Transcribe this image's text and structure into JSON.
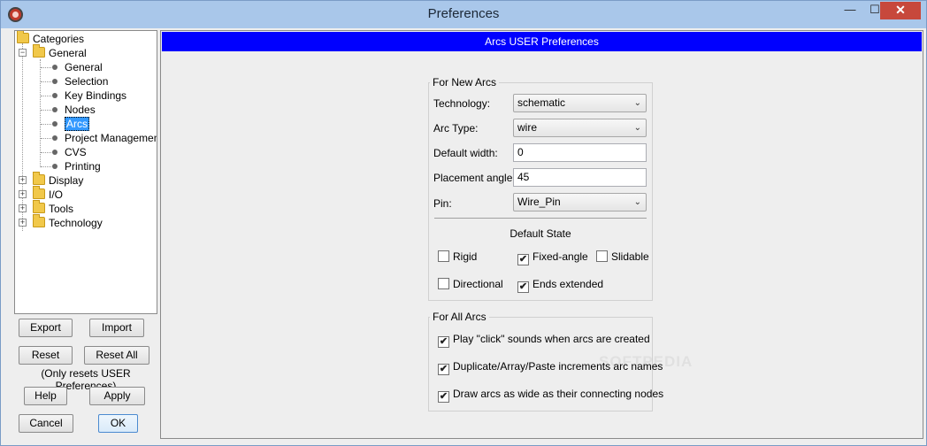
{
  "window": {
    "title": "Preferences",
    "minimize_glyph": "—",
    "maximize_glyph": "☐",
    "close_glyph": "✕"
  },
  "tree": {
    "root": "Categories",
    "general": "General",
    "general_children": [
      "General",
      "Selection",
      "Key Bindings",
      "Nodes",
      "Arcs",
      "Project Management",
      "CVS",
      "Printing"
    ],
    "display": "Display",
    "io": "I/O",
    "tools": "Tools",
    "technology": "Technology",
    "selected": "Arcs"
  },
  "buttons": {
    "export": "Export",
    "import": "Import",
    "reset": "Reset",
    "reset_all": "Reset All",
    "reset_note": "(Only resets USER Preferences)",
    "help": "Help",
    "apply": "Apply",
    "cancel": "Cancel",
    "ok": "OK"
  },
  "panel": {
    "header": "Arcs USER Preferences",
    "new_arcs": {
      "title": "For New Arcs",
      "technology_label": "Technology:",
      "technology_value": "schematic",
      "arc_type_label": "Arc Type:",
      "arc_type_value": "wire",
      "default_width_label": "Default width:",
      "default_width_value": "0",
      "placement_angle_label": "Placement angle:",
      "placement_angle_value": "45",
      "pin_label": "Pin:",
      "pin_value": "Wire_Pin",
      "default_state_title": "Default State",
      "rigid": {
        "label": "Rigid",
        "checked": false
      },
      "fixed_angle": {
        "label": "Fixed-angle",
        "checked": true
      },
      "slidable": {
        "label": "Slidable",
        "checked": false
      },
      "directional": {
        "label": "Directional",
        "checked": false
      },
      "ends_extended": {
        "label": "Ends extended",
        "checked": true
      }
    },
    "all_arcs": {
      "title": "For All Arcs",
      "click_sounds": {
        "label": "Play \"click\" sounds when arcs are created",
        "checked": true
      },
      "increments": {
        "label": "Duplicate/Array/Paste increments arc names",
        "checked": true
      },
      "wide_arcs": {
        "label": "Draw arcs as wide as their connecting nodes",
        "checked": true
      }
    }
  },
  "watermark": "SOFTPEDIA",
  "check_glyph": "✔",
  "dropdown_glyph": "⌄"
}
